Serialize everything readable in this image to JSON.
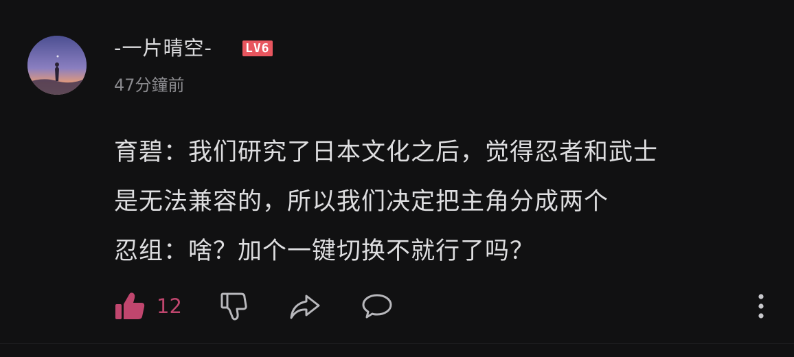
{
  "comment": {
    "author": {
      "name": "-一片晴空-",
      "level": "LV6"
    },
    "timestamp": "47分鐘前",
    "lines": [
      "育碧：我们研究了日本文化之后，觉得忍者和武士",
      "是无法兼容的，所以我们决定把主角分成两个",
      "忍组：啥？加个一键切换不就行了吗？"
    ],
    "actions": {
      "like_count": "12",
      "like_icon": "thumbs-up-icon",
      "dislike_icon": "thumbs-down-icon",
      "share_icon": "share-icon",
      "reply_icon": "reply-bubble-icon",
      "more_icon": "more-vertical-icon"
    }
  },
  "colors": {
    "background": "#111112",
    "like_active": "#c0466e",
    "level_badge": "#e8565f",
    "meta_text": "#8a8a8e"
  }
}
